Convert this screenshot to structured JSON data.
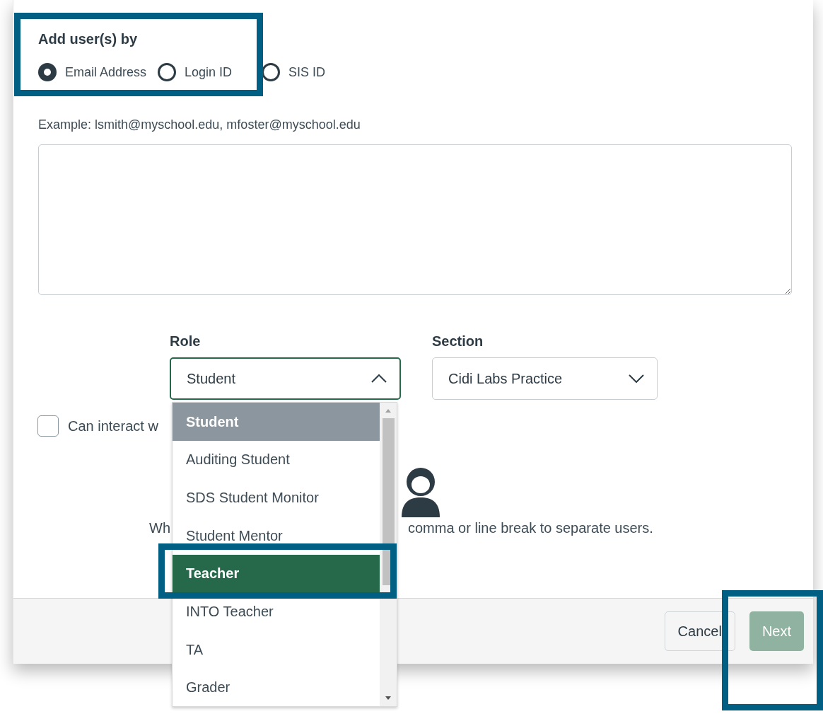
{
  "add_by": {
    "title": "Add user(s) by",
    "options": [
      {
        "label": "Email Address",
        "selected": true
      },
      {
        "label": "Login ID",
        "selected": false
      },
      {
        "label": "SIS ID",
        "selected": false
      }
    ]
  },
  "example": "Example: lsmith@myschool.edu, mfoster@myschool.edu",
  "role": {
    "label": "Role",
    "value": "Student",
    "open": true
  },
  "section": {
    "label": "Section",
    "value": "Cidi Labs Practice",
    "open": false
  },
  "interact_checkbox": {
    "label": "Can interact w",
    "checked": false
  },
  "hint": {
    "before": "Wh",
    "after": "comma or line break to separate users."
  },
  "role_options": [
    {
      "label": "Student",
      "selected": true,
      "highlighted": false
    },
    {
      "label": "Auditing Student",
      "selected": false,
      "highlighted": false
    },
    {
      "label": "SDS Student Monitor",
      "selected": false,
      "highlighted": false
    },
    {
      "label": "Student Mentor",
      "selected": false,
      "highlighted": false
    },
    {
      "label": "Teacher",
      "selected": false,
      "highlighted": true
    },
    {
      "label": "INTO Teacher",
      "selected": false,
      "highlighted": false
    },
    {
      "label": "TA",
      "selected": false,
      "highlighted": false
    },
    {
      "label": "Grader",
      "selected": false,
      "highlighted": false
    }
  ],
  "buttons": [
    {
      "label": "Cancel",
      "kind": "secondary",
      "disabled": false
    },
    {
      "label": "Next",
      "kind": "primary",
      "disabled": true
    }
  ]
}
